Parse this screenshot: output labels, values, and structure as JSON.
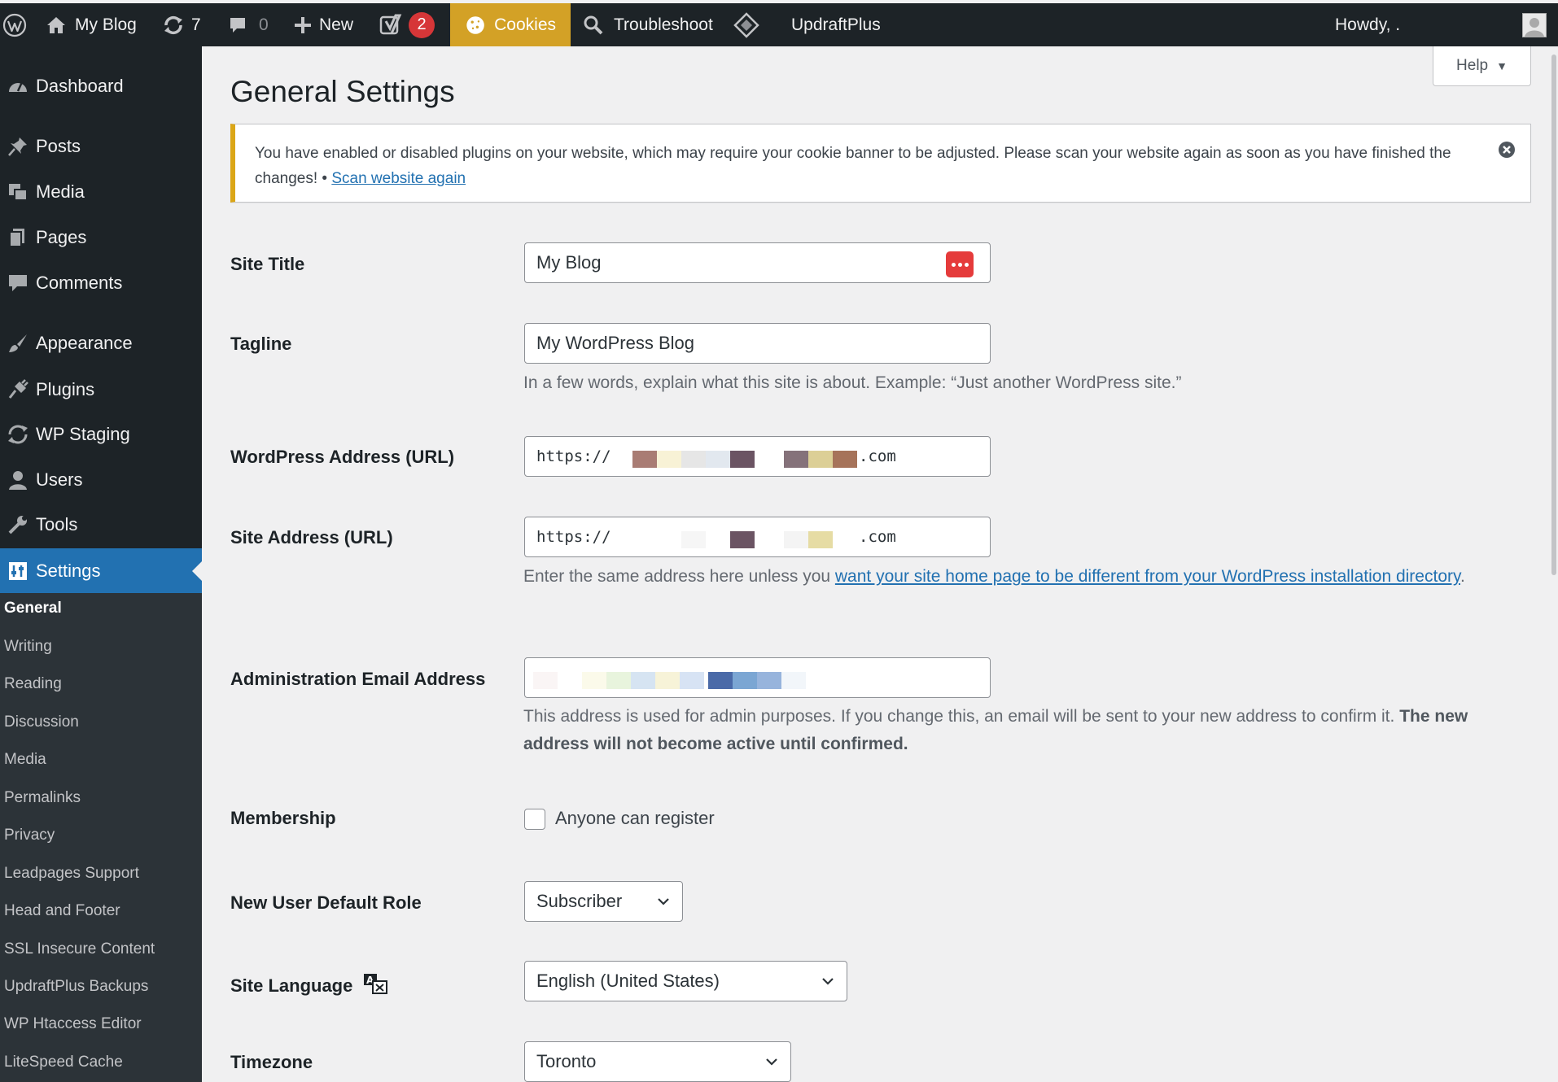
{
  "adminbar": {
    "site_name": "My Blog",
    "updates_count": "7",
    "comments_count": "0",
    "new_label": "New",
    "yoast_badge": "2",
    "cookies_label": "Cookies",
    "troubleshoot_label": "Troubleshoot",
    "updraft_label": "UpdraftPlus",
    "howdy": "Howdy, ."
  },
  "sidebar": {
    "items": [
      {
        "label": "Dashboard",
        "icon": "dashboard-icon"
      },
      {
        "label": "Posts",
        "icon": "pin-icon"
      },
      {
        "label": "Media",
        "icon": "media-icon"
      },
      {
        "label": "Pages",
        "icon": "pages-icon"
      },
      {
        "label": "Comments",
        "icon": "comment-icon"
      },
      {
        "label": "Appearance",
        "icon": "brush-icon"
      },
      {
        "label": "Plugins",
        "icon": "plugin-icon"
      },
      {
        "label": "WP Staging",
        "icon": "sync-icon"
      },
      {
        "label": "Users",
        "icon": "user-icon"
      },
      {
        "label": "Tools",
        "icon": "wrench-icon"
      },
      {
        "label": "Settings",
        "icon": "settings-icon"
      }
    ],
    "submenu": [
      "General",
      "Writing",
      "Reading",
      "Discussion",
      "Media",
      "Permalinks",
      "Privacy",
      "Leadpages Support",
      "Head and Footer",
      "SSL Insecure Content",
      "UpdraftPlus Backups",
      "WP Htaccess Editor",
      "LiteSpeed Cache"
    ]
  },
  "help_label": "Help",
  "page_title": "General Settings",
  "notice": {
    "text": "You have enabled or disabled plugins on your website, which may require your cookie banner to be adjusted. Please scan your website again as soon as you have finished the changes! • ",
    "link": "Scan website again"
  },
  "fields": {
    "site_title": {
      "label": "Site Title",
      "value": "My Blog"
    },
    "tagline": {
      "label": "Tagline",
      "value": "My WordPress Blog",
      "desc": "In a few words, explain what this site is about. Example: “Just another WordPress site.”"
    },
    "wp_address": {
      "label": "WordPress Address (URL)",
      "prefix": "https://",
      "suffix": ".com"
    },
    "site_address": {
      "label": "Site Address (URL)",
      "prefix": "https://",
      "suffix": ".com",
      "desc_before": "Enter the same address here unless you ",
      "desc_link": "want your site home page to be different from your WordPress installation directory",
      "desc_after": "."
    },
    "admin_email": {
      "label": "Administration Email Address",
      "desc": "This address is used for admin purposes. If you change this, an email will be sent to your new address to confirm it. ",
      "desc_strong": "The new address will not become active until confirmed."
    },
    "membership": {
      "label": "Membership",
      "checkbox_label": "Anyone can register",
      "checked": false
    },
    "default_role": {
      "label": "New User Default Role",
      "value": "Subscriber"
    },
    "site_language": {
      "label": "Site Language",
      "value": "English (United States)"
    },
    "timezone": {
      "label": "Timezone",
      "value": "Toronto"
    }
  },
  "colors": {
    "accent": "#2271b1",
    "adminbar": "#1d2327",
    "cookies_bg": "#d3a126",
    "notice_border": "#dba617",
    "badge": "#d63638"
  }
}
